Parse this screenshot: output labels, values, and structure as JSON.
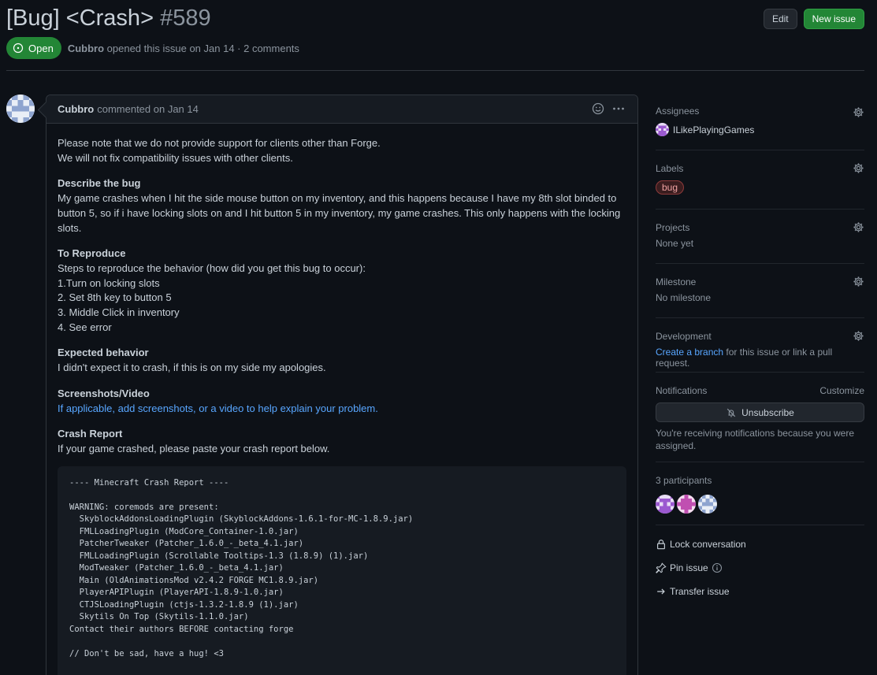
{
  "issue": {
    "title": "[Bug] <Crash>",
    "number": "#589",
    "state": "Open",
    "author": "Cubbro",
    "meta": "opened this issue on Jan 14 · 2 comments"
  },
  "header_buttons": {
    "edit": "Edit",
    "new_issue": "New issue"
  },
  "comment": {
    "author": "Cubbro",
    "when": "commented on Jan 14",
    "note_1": "Please note that we do not provide support for clients other than Forge.",
    "note_2": "We will not fix compatibility issues with other clients.",
    "describe_heading": "Describe the bug",
    "describe_text": "My game crashes when I hit the side mouse button on my inventory, and this happens because I have my 8th slot binded to button 5, so if i have locking slots on and I hit button 5 in my inventory, my game crashes. This only happens with the locking slots.",
    "reproduce_heading": "To Reproduce",
    "reproduce_intro": "Steps to reproduce the behavior (how did you get this bug to occur):",
    "steps": [
      "1.Turn on locking slots",
      "2. Set 8th key to button 5",
      "3. Middle Click in inventory",
      "4. See error"
    ],
    "expected_heading": "Expected behavior",
    "expected_text": "I didn't expect it to crash, if this is on my side my apologies.",
    "screens_heading": "Screenshots/Video",
    "screens_text": "If applicable, add screenshots, or a video to help explain your problem.",
    "crash_heading": "Crash Report",
    "crash_text": "If your game crashed, please paste your crash report below.",
    "crash_code": "---- Minecraft Crash Report ----\n\nWARNING: coremods are present:\n  SkyblockAddonsLoadingPlugin (SkyblockAddons-1.6.1-for-MC-1.8.9.jar)\n  FMLLoadingPlugin (ModCore_Container-1.0.jar)\n  PatcherTweaker (Patcher_1.6.0_-_beta_4.1.jar)\n  FMLLoadingPlugin (Scrollable Tooltips-1.3 (1.8.9) (1).jar)\n  ModTweaker (Patcher_1.6.0_-_beta_4.1.jar)\n  Main (OldAnimationsMod v2.4.2 FORGE MC1.8.9.jar)\n  PlayerAPIPlugin (PlayerAPI-1.8.9-1.0.jar)\n  CTJSLoadingPlugin (ctjs-1.3.2-1.8.9 (1).jar)\n  Skytils On Top (Skytils-1.1.0.jar)\nContact their authors BEFORE contacting forge\n\n// Don't be sad, have a hug! <3"
  },
  "sidebar": {
    "assignees_title": "Assignees",
    "assignee": "ILikePlayingGames",
    "labels_title": "Labels",
    "label": "bug",
    "projects_title": "Projects",
    "projects_value": "None yet",
    "milestone_title": "Milestone",
    "milestone_value": "No milestone",
    "development_title": "Development",
    "development_link": "Create a branch",
    "development_rest": " for this issue or link a pull request.",
    "notifications_title": "Notifications",
    "customize": "Customize",
    "unsubscribe": "Unsubscribe",
    "notif_reason": "You're receiving notifications because you were assigned.",
    "participants": "3 participants",
    "lock": "Lock conversation",
    "pin": "Pin issue",
    "transfer": "Transfer issue"
  },
  "colors": {
    "bg": "#0d1117",
    "green": "#238636",
    "link": "#58a6ff",
    "muted": "#8b949e"
  }
}
